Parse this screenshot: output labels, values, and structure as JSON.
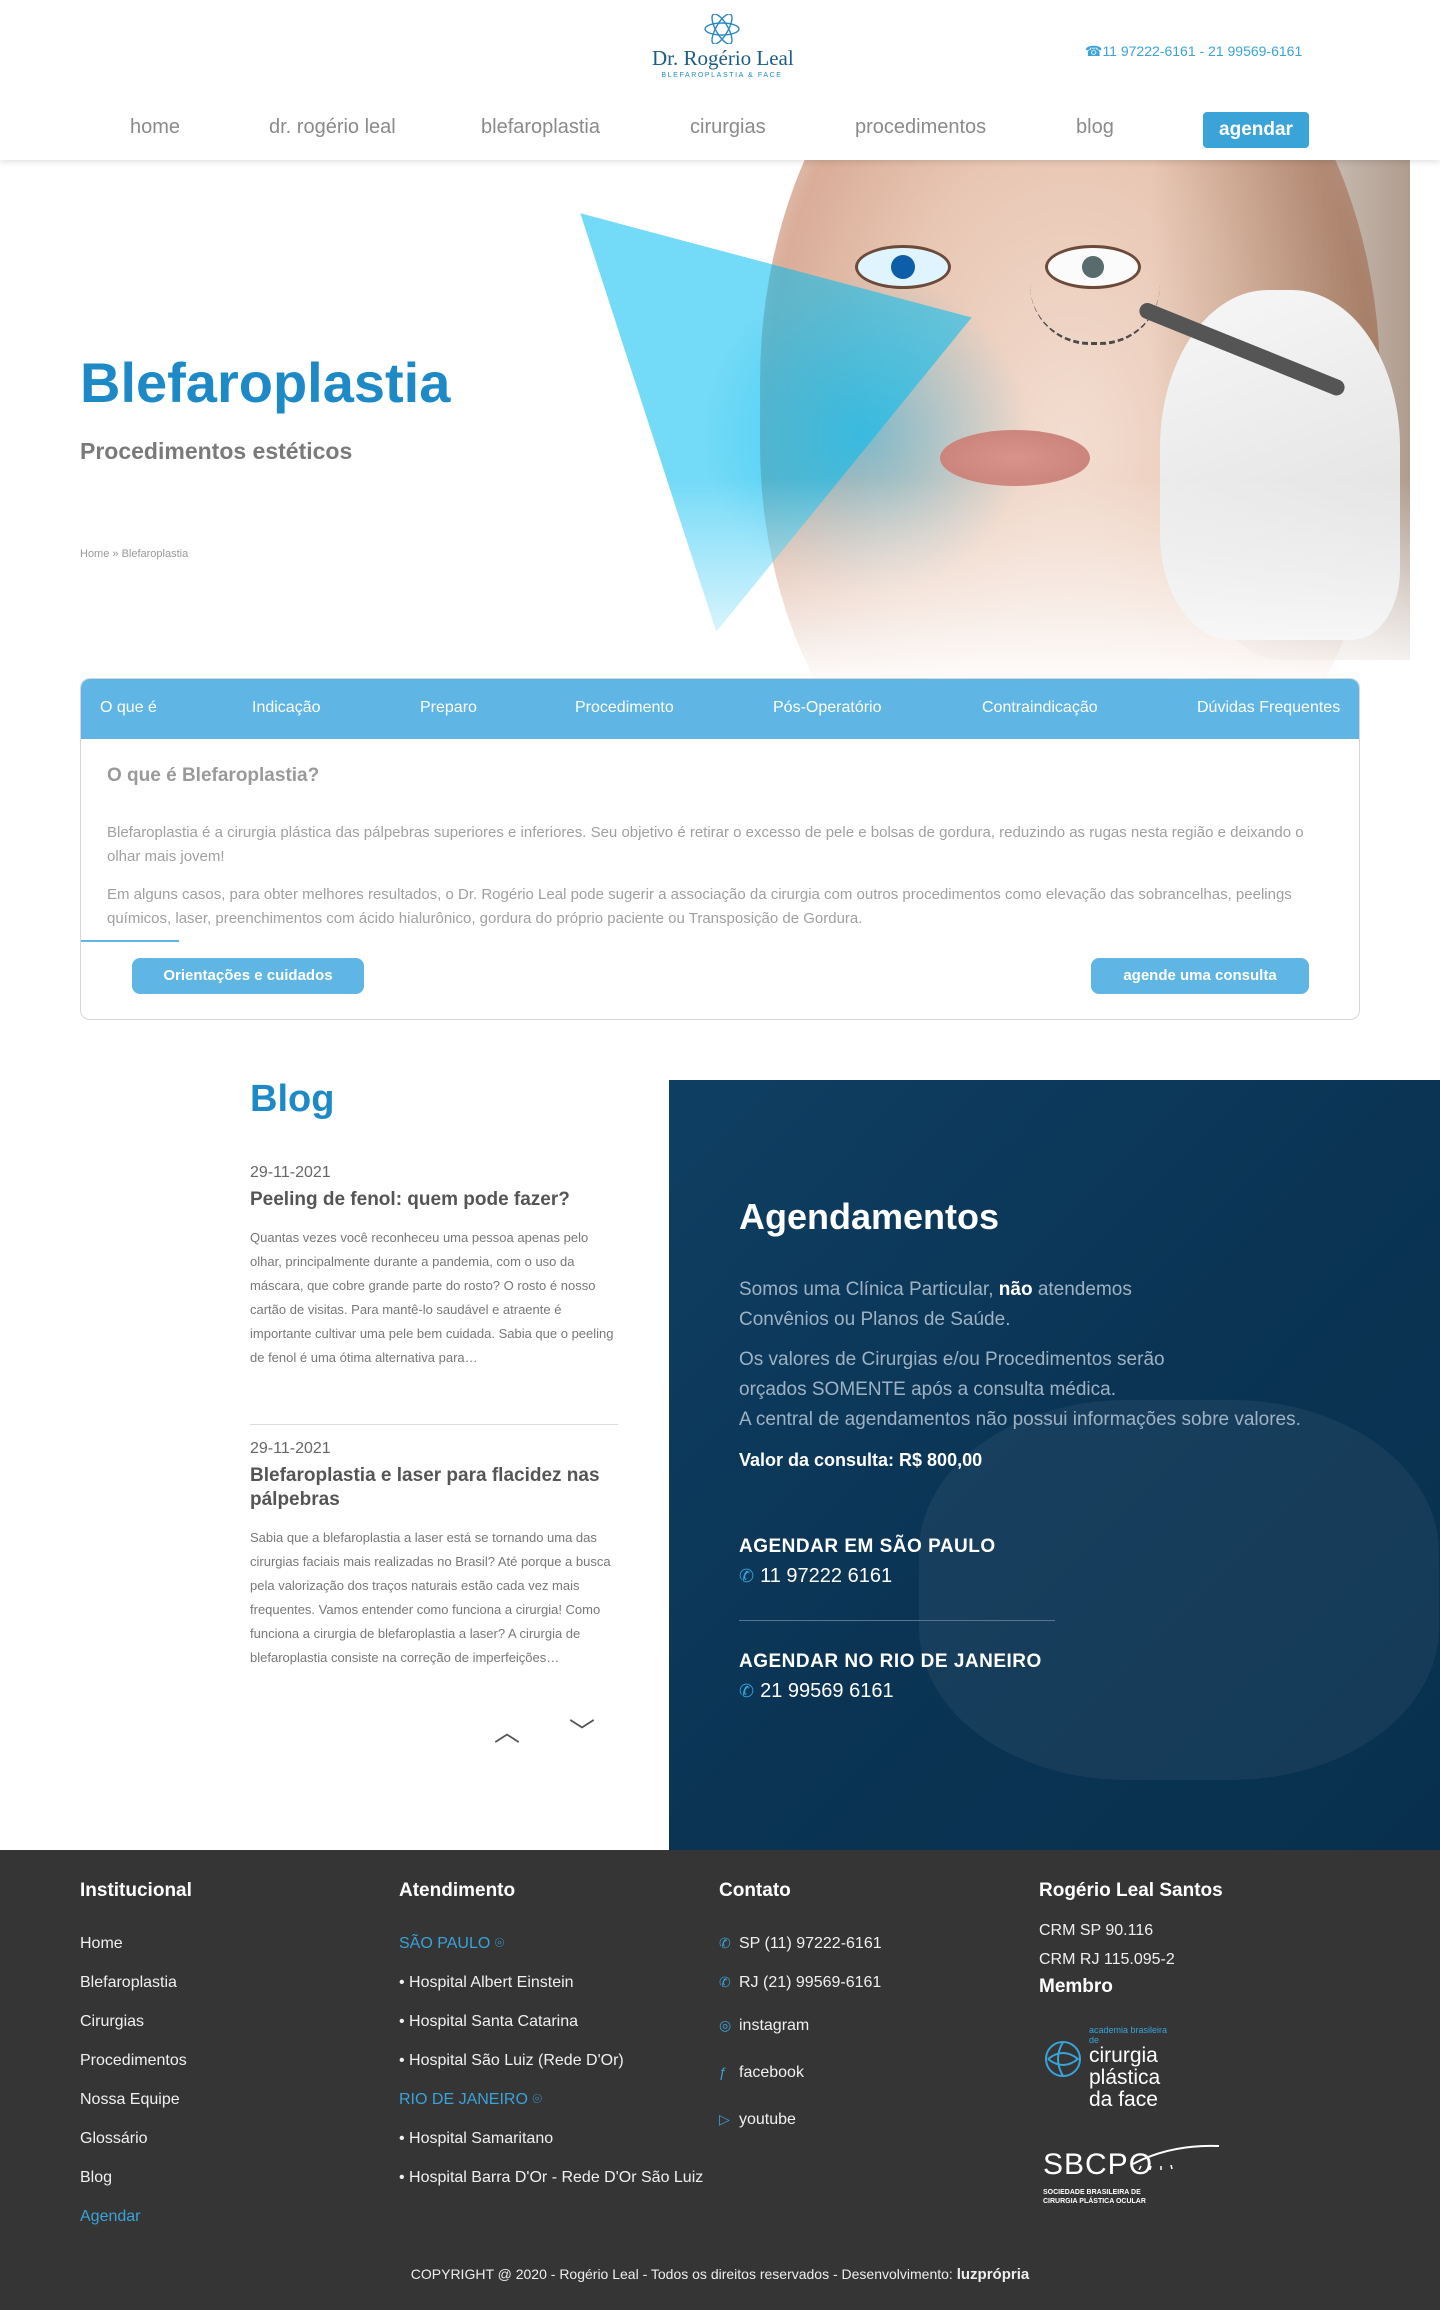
{
  "header": {
    "logo_name": "Dr. Rogério Leal",
    "logo_sub": "BLEFAROPLASTIA & FACE",
    "phones": "☎11 97222-6161 - 21 99569-6161",
    "nav": {
      "home": "home",
      "doctor": "dr. rogério leal",
      "blefaroplastia": "blefaroplastia",
      "cirurgias": "cirurgias",
      "procedimentos": "procedimentos",
      "blog": "blog",
      "agendar": "agendar"
    }
  },
  "hero": {
    "title": "Blefaroplastia",
    "subtitle": "Procedimentos estéticos",
    "breadcrumb": "Home » Blefaroplastia"
  },
  "tabs": {
    "labels": [
      "O que é",
      "Indicação",
      "Preparo",
      "Procedimento",
      "Pós-Operatório",
      "Contraindicação",
      "Dúvidas Frequentes"
    ],
    "heading": "O que é Blefaroplastia?",
    "p1": "Blefaroplastia é a cirurgia plástica das pálpebras superiores e inferiores. Seu objetivo é retirar o excesso de pele e bolsas de gordura, reduzindo as rugas nesta região e deixando o olhar mais jovem!",
    "p2": "Em alguns casos, para obter melhores resultados, o Dr. Rogério Leal pode sugerir a associação da cirurgia com outros procedimentos como elevação das sobrancelhas, peelings químicos, laser, preenchimentos com ácido hialurônico, gordura do próprio paciente ou Transposição de Gordura.",
    "btn_left": "Orientações e cuidados",
    "btn_right": "agende uma consulta"
  },
  "blog": {
    "title": "Blog",
    "posts": [
      {
        "date": "29-11-2021",
        "title": "Peeling de fenol: quem pode fazer?",
        "excerpt": "  Quantas vezes você reconheceu uma pessoa apenas pelo olhar, principalmente durante a pandemia, com o uso da máscara, que cobre grande parte do rosto? O rosto é nosso cartão de visitas. Para mantê-lo saudável e atraente é importante cultivar uma pele bem cuidada. Sabia que o peeling de fenol é uma ótima alternativa para…"
      },
      {
        "date": "29-11-2021",
        "title": "Blefaroplastia e laser para flacidez nas pálpebras",
        "excerpt": "  Sabia que a blefaroplastia a laser está se tornando uma das cirurgias faciais mais realizadas no Brasil? Até porque a busca pela valorização dos traços naturais estão cada vez mais frequentes.  Vamos entender como funciona a cirurgia!  Como funciona a cirurgia de blefaroplastia a laser?  A cirurgia de blefaroplastia consiste na correção de imperfeições…"
      }
    ],
    "prev": "︿",
    "next": "﹀"
  },
  "agenda": {
    "title": "Agendamentos",
    "line1a": "Somos uma Clínica Particular, ",
    "line1b": "não",
    "line1c": " atendemos Convênios ou Planos de Saúde.",
    "line2": "Os valores de Cirurgias e/ou Procedimentos serão orçados SOMENTE após a consulta médica.",
    "line3": "A central de agendamentos não possui informações sobre valores.",
    "price": "Valor da consulta: R$ 800,00",
    "sp_label": "AGENDAR EM SÃO PAULO",
    "sp_phone": "11 97222 6161",
    "rj_label": "AGENDAR NO RIO DE JANEIRO",
    "rj_phone": "21 99569 6161"
  },
  "footer": {
    "inst_title": "Institucional",
    "inst_items": [
      "Home",
      "Blefaroplastia",
      "Cirurgias",
      "Procedimentos",
      "Nossa Equipe",
      "Glossário",
      "Blog",
      "Agendar"
    ],
    "atend_title": "Atendimento",
    "sp": "SÃO PAULO",
    "sp_items": [
      "• Hospital Albert Einstein",
      "• Hospital Santa Catarina",
      "• Hospital São Luiz (Rede D'Or)"
    ],
    "rj": "RIO DE JANEIRO",
    "rj_items": [
      "• Hospital Samaritano",
      "• Hospital Barra D'Or - Rede D'Or São Luiz"
    ],
    "contato_title": "Contato",
    "contato": {
      "sp": "SP (11) 97222-6161",
      "rj": "RJ (21) 99569-6161",
      "instagram": "instagram",
      "facebook": "facebook",
      "youtube": "youtube"
    },
    "doc_title": "Rogério Leal Santos",
    "crm_sp": "CRM SP 90.116",
    "crm_rj": "CRM RJ 115.095-2",
    "membro": "Membro",
    "abcp_small": "academia brasileira de",
    "abcp_big1": "cirurgia",
    "abcp_big2": "plástica",
    "abcp_big3": "da face",
    "sbcpo": "SBCPO",
    "sbcpo_sub1": "SOCIEDADE BRASILEIRA DE",
    "sbcpo_sub2": "CIRURGIA PLÁSTICA OCULAR",
    "copyright": "COPYRIGHT @ 2020 - Rogério Leal - Todos os direitos reservados - Desenvolvimento: ",
    "dev": "luzprópria"
  },
  "colors": {
    "brand_blue": "#1d8ac7",
    "tab_blue": "#5fb6e4",
    "agenda_bg": "#0b3454",
    "footer_bg": "#353536"
  }
}
